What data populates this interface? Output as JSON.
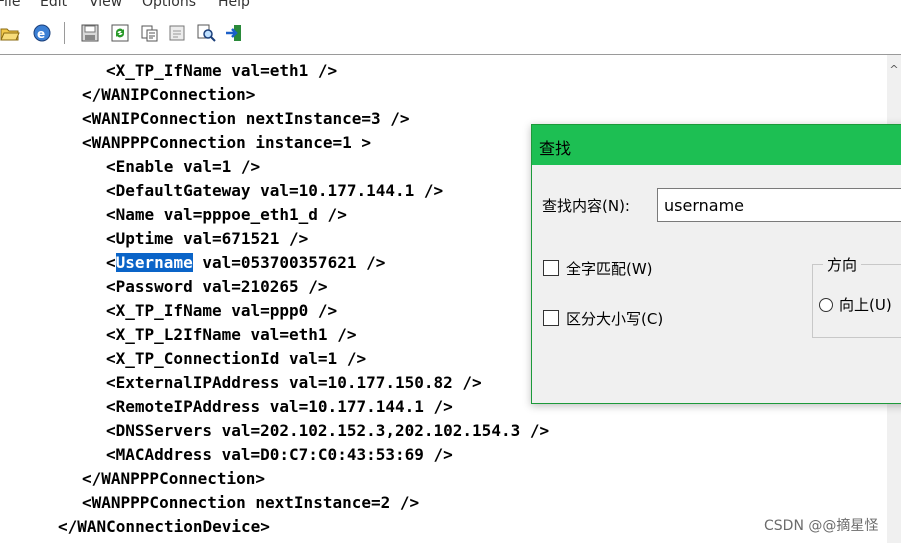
{
  "menu": [
    "File",
    "Edit",
    "View",
    "Options",
    "Help"
  ],
  "toolbar": {
    "icons": [
      "open-folder-icon",
      "browser-icon",
      "save-icon",
      "refresh-icon",
      "copy-icon",
      "properties-icon",
      "search-icon",
      "exit-icon"
    ]
  },
  "editor": {
    "lines": [
      "<X_TP_IfName val=eth1 />",
      "</WANIPConnection>",
      "<WANIPConnection nextInstance=3 />",
      "<WANPPPConnection instance=1 >",
      "<Enable val=1 />",
      "<DefaultGateway val=10.177.144.1 />",
      "<Name val=pppoe_eth1_d />",
      "<Uptime val=671521 />",
      "<",
      "<Password val=210265 />",
      "<X_TP_IfName val=ppp0 />",
      "<X_TP_L2IfName val=eth1 />",
      "<X_TP_ConnectionId val=1 />",
      "<ExternalIPAddress val=10.177.150.82 />",
      "<RemoteIPAddress val=10.177.144.1 />",
      "<DNSServers val=202.102.152.3,202.102.154.3 />",
      "<MACAddress val=D0:C7:C0:43:53:69 />",
      "</WANPPPConnection>",
      "<WANPPPConnection nextInstance=2 />",
      "</WANConnectionDevice>"
    ],
    "highlight_word": "Username",
    "highlight_rest": " val=053700357621 />"
  },
  "find_dialog": {
    "title": "查找",
    "find_label": "查找内容(N):",
    "find_value": "username",
    "whole_word": "全字匹配(W)",
    "match_case": "区分大小写(C)",
    "direction_label": "方向",
    "direction_up": "向上(U)"
  },
  "watermark": "CSDN @@摘星怪"
}
